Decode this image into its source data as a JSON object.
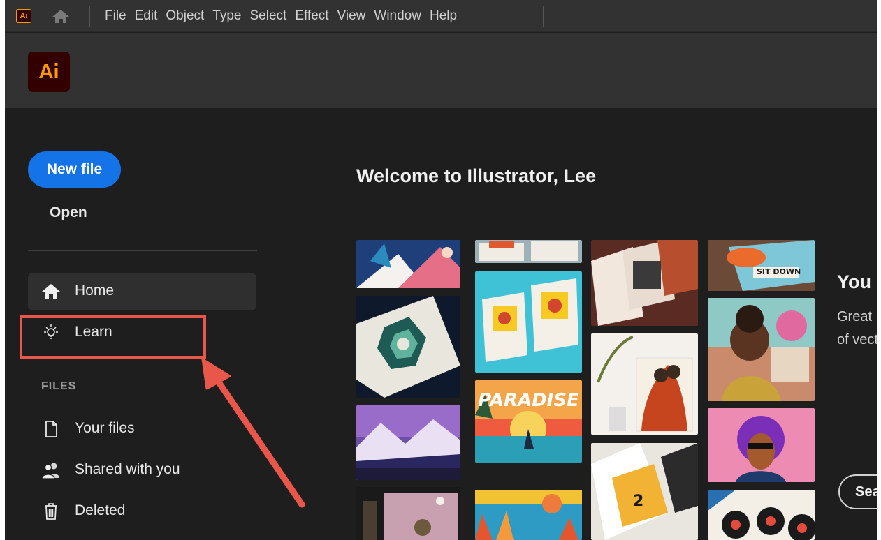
{
  "menubar": {
    "app_icon": "Ai",
    "items": [
      "File",
      "Edit",
      "Object",
      "Type",
      "Select",
      "Effect",
      "View",
      "Window",
      "Help"
    ]
  },
  "header": {
    "logo": "Ai"
  },
  "sidebar": {
    "new_file": "New file",
    "open": "Open",
    "nav": [
      {
        "label": "Home",
        "icon": "home-icon"
      },
      {
        "label": "Learn",
        "icon": "lightbulb-icon"
      }
    ],
    "files_heading": "FILES",
    "files": [
      {
        "label": "Your files",
        "icon": "file-icon"
      },
      {
        "label": "Shared with you",
        "icon": "people-icon"
      },
      {
        "label": "Deleted",
        "icon": "trash-icon"
      }
    ]
  },
  "main": {
    "welcome": "Welcome to Illustrator, Lee",
    "promo_title": "You l",
    "promo_line1": "Great",
    "promo_line2": "of vect",
    "promo_button": "Sea",
    "tile_texts": {
      "paradise": "PARADISE",
      "sit_down": "SIT DOWN"
    }
  },
  "colors": {
    "accent_blue": "#1473e6",
    "ai_orange": "#ff9a00",
    "annotation_red": "#e8574a"
  }
}
